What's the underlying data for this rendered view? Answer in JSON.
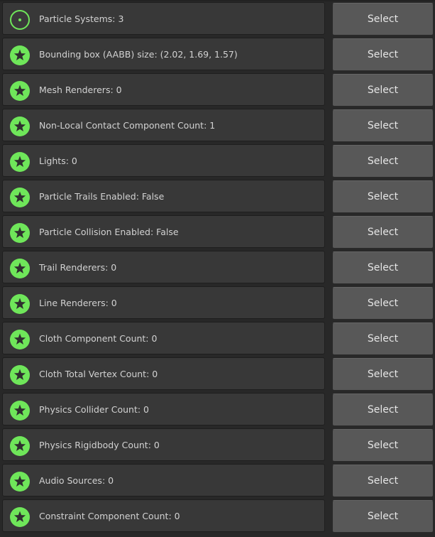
{
  "colors": {
    "background": "#282828",
    "row_background": "#383838",
    "button_background": "#585858",
    "icon_green": "#6fe65a",
    "icon_dark": "#2f2f2f",
    "text": "#d2d2d2"
  },
  "rows": [
    {
      "label": "Particle Systems: 3",
      "icon": "target-icon",
      "button": "Select"
    },
    {
      "label": "Bounding box (AABB) size: (2.02, 1.69, 1.57)",
      "icon": "star-icon",
      "button": "Select"
    },
    {
      "label": "Mesh Renderers: 0",
      "icon": "star-icon",
      "button": "Select"
    },
    {
      "label": "Non-Local Contact Component Count: 1",
      "icon": "star-icon",
      "button": "Select"
    },
    {
      "label": "Lights: 0",
      "icon": "star-icon",
      "button": "Select"
    },
    {
      "label": "Particle Trails Enabled: False",
      "icon": "star-icon",
      "button": "Select"
    },
    {
      "label": "Particle Collision Enabled: False",
      "icon": "star-icon",
      "button": "Select"
    },
    {
      "label": "Trail Renderers: 0",
      "icon": "star-icon",
      "button": "Select"
    },
    {
      "label": "Line Renderers: 0",
      "icon": "star-icon",
      "button": "Select"
    },
    {
      "label": "Cloth Component Count: 0",
      "icon": "star-icon",
      "button": "Select"
    },
    {
      "label": "Cloth Total Vertex Count: 0",
      "icon": "star-icon",
      "button": "Select"
    },
    {
      "label": "Physics Collider Count: 0",
      "icon": "star-icon",
      "button": "Select"
    },
    {
      "label": "Physics Rigidbody Count: 0",
      "icon": "star-icon",
      "button": "Select"
    },
    {
      "label": "Audio Sources: 0",
      "icon": "star-icon",
      "button": "Select"
    },
    {
      "label": "Constraint Component Count: 0",
      "icon": "star-icon",
      "button": "Select"
    }
  ]
}
